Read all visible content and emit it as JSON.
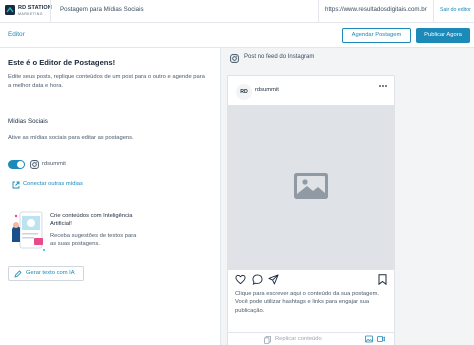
{
  "header": {
    "logo_line1": "RD STATION",
    "logo_line2": "MARKETING",
    "title": "Postagem para Mídias Sociais",
    "url": "https://www.resultadosdigitais.com.br",
    "exit": "Sair do editor"
  },
  "toolbar": {
    "label": "Editor",
    "schedule_label": "Agendar Postagem",
    "publish_label": "Publicar Agora"
  },
  "sidebar": {
    "title": "Este é o Editor de Postagens!",
    "description": "Edite seus posts, replique conteúdos de um post para o outro e agende para a melhor data e hora.",
    "social_title": "Mídias Sociais",
    "social_description": "Ative as mídias sociais para editar as postagens.",
    "account_name": "rdsummit",
    "toggle_on": true,
    "connect_link": "Conectar outras mídias",
    "ai_title": "Crie conteúdos com Inteligência Artificial!",
    "ai_description": "Receba sugestões de textos para as suas postagens.",
    "ai_button": "Gerar texto com IA"
  },
  "preview": {
    "network_label": "Post no feed do Instagram",
    "avatar_initials": "RD",
    "username": "rdsummit",
    "caption": "Clique para escrever aqui o conteúdo da sua postagem. Você pode utilizar hashtags e links para engajar sua publicação.",
    "copy_label": "Replicar conteúdo"
  },
  "colors": {
    "accent": "#1b8ab8",
    "text_dark": "#1b2a3c",
    "preview_bg": "#f2f4f6",
    "media_bg": "#dfe2e6"
  }
}
